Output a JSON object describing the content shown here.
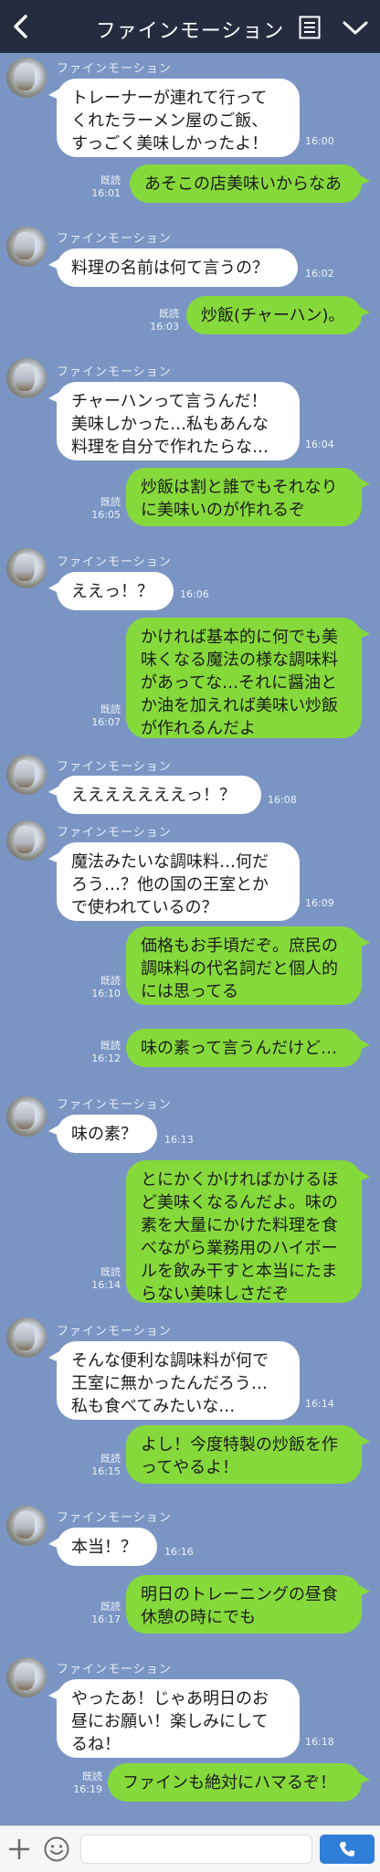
{
  "header": {
    "title": "ファインモーション"
  },
  "composer": {
    "placeholder": ""
  },
  "messages": [
    {
      "side": "in",
      "sender": "ファインモーション",
      "text": "トレーナーが連れて行って\nくれたラーメン屋のご飯、\nすっごく美味しかったよ！",
      "time": "16:00"
    },
    {
      "side": "out",
      "read": "既読",
      "text": "あそこの店美味いからなあ",
      "time": "16:01"
    },
    {
      "side": "in",
      "sender": "ファインモーション",
      "text": "料理の名前は何て言うの？",
      "time": "16:02"
    },
    {
      "side": "out",
      "read": "既読",
      "text": "炒飯(チャーハン)。",
      "time": "16:03"
    },
    {
      "side": "in",
      "sender": "ファインモーション",
      "text": "チャーハンって言うんだ！\n美味しかった…私もあんな\n料理を自分で作れたらな…",
      "time": "16:04"
    },
    {
      "side": "out",
      "read": "既読",
      "text": "炒飯は割と誰でもそれなり\nに美味いのが作れるぞ",
      "time": "16:05"
    },
    {
      "side": "in",
      "sender": "ファインモーション",
      "text": "ええっ！？",
      "time": "16:06"
    },
    {
      "side": "out",
      "read": "既読",
      "text": "かければ基本的に何でも美\n味くなる魔法の様な調味料\nがあってな…それに醤油と\nか油を加えれば美味い炒飯\nが作れるんだよ",
      "time": "16:07"
    },
    {
      "side": "in",
      "sender": "ファインモーション",
      "text": "えええええええっ！？",
      "time": "16:08"
    },
    {
      "side": "in",
      "sender": "ファインモーション",
      "text": "魔法みたいな調味料…何だ\nろう…？他の国の王室とか\nで使われているの？",
      "time": "16:09"
    },
    {
      "side": "out",
      "read": "既読",
      "text": "価格もお手頃だぞ。庶民の\n調味料の代名詞だと個人的\nには思ってる",
      "time": "16:10"
    },
    {
      "side": "out",
      "read": "既読",
      "text": "味の素って言うんだけど…",
      "time": "16:12"
    },
    {
      "side": "in",
      "sender": "ファインモーション",
      "text": "味の素？",
      "time": "16:13"
    },
    {
      "side": "out",
      "read": "既読",
      "text": "とにかくかければかけるほ\nど美味くなるんだよ。味の\n素を大量にかけた料理を食\nべながら業務用のハイボー\nルを飲み干すと本当にたま\nらない美味しさだぞ",
      "time": "16:14"
    },
    {
      "side": "in",
      "sender": "ファインモーション",
      "text": "そんな便利な調味料が何で\n王室に無かったんだろう…\n私も食べてみたいな…",
      "time": "16:14"
    },
    {
      "side": "out",
      "read": "既読",
      "text": "よし！今度特製の炒飯を作\nってやるよ！",
      "time": "16:15"
    },
    {
      "side": "in",
      "sender": "ファインモーション",
      "text": "本当！？",
      "time": "16:16"
    },
    {
      "side": "out",
      "read": "既読",
      "text": "明日のトレーニングの昼食\n休憩の時にでも",
      "time": "16:17"
    },
    {
      "side": "in",
      "sender": "ファインモーション",
      "text": "やったあ！じゃあ明日のお\n昼にお願い！楽しみにして\nるね！",
      "time": "16:18"
    },
    {
      "side": "out",
      "read": "既読",
      "text": "ファインも絶対にハマるぞ！",
      "time": "16:19"
    }
  ]
}
